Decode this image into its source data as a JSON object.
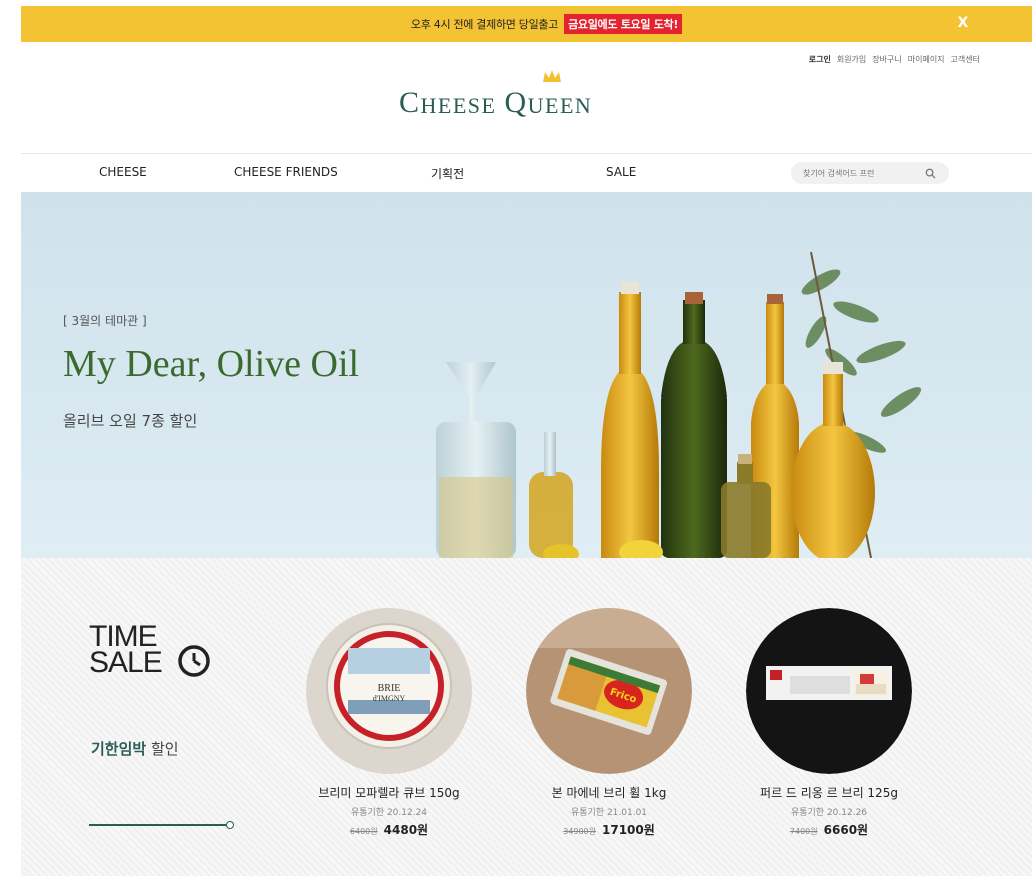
{
  "top_banner": {
    "message": "오후 4시 전에 결제하면 당일출고",
    "highlight": "금요일에도 토요일 도착!",
    "close": "X"
  },
  "util_links": [
    "로그인",
    "회원가입",
    "장바구니",
    "마이페이지",
    "고객센터"
  ],
  "logo": {
    "text": "CHEESE QUEEN"
  },
  "nav": {
    "items": [
      "CHEESE",
      "CHEESE FRIENDS",
      "기획전",
      "SALE"
    ],
    "search_placeholder": "찾기어 검색어드 프런"
  },
  "hero": {
    "tag": "[ 3월의 테마관 ]",
    "title": "My Dear, Olive Oil",
    "subtitle": "올리브 오일 7종 할인"
  },
  "time_sale": {
    "title_line1": "TIME",
    "title_line2": "SALE",
    "sub_bold": "기한임박",
    "sub_rest": " 할인",
    "products": [
      {
        "name": "브리미 모파렐라 큐브 150g",
        "expiry": "유통기한 20.12.24",
        "original_price": "6400원",
        "sale_price": "4480원",
        "image": "brie-de-meaux-cheese"
      },
      {
        "name": "본 마에네 브리 휠 1kg",
        "expiry": "유통기한 21.01.01",
        "original_price": "34900원",
        "sale_price": "17100원",
        "image": "frico-cheese-pack"
      },
      {
        "name": "퍼르 드 리옹 르 브리 125g",
        "expiry": "유통기한 20.12.26",
        "original_price": "7400원",
        "sale_price": "6660원",
        "image": "cheese-cake-box"
      }
    ]
  },
  "colors": {
    "banner": "#f3c333",
    "highlight": "#e4232f",
    "brand_green": "#2b5d54",
    "hero_title": "#3b6a2e"
  }
}
